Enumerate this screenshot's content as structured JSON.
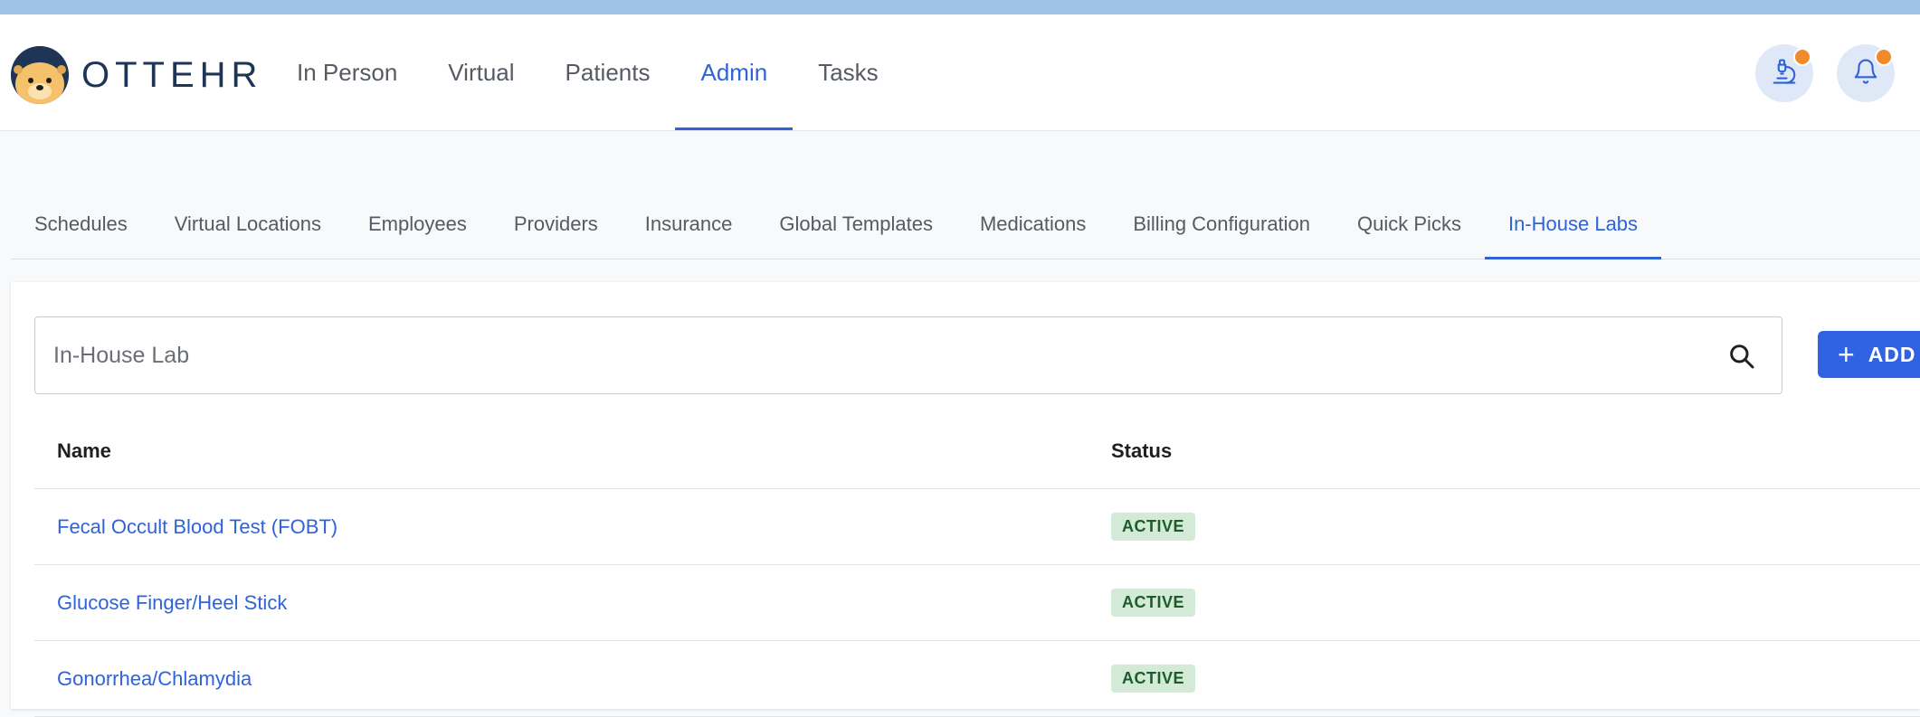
{
  "app": {
    "logo_text": "OTTEHR"
  },
  "main_nav": [
    {
      "label": "In Person",
      "active": false
    },
    {
      "label": "Virtual",
      "active": false
    },
    {
      "label": "Patients",
      "active": false
    },
    {
      "label": "Admin",
      "active": true
    },
    {
      "label": "Tasks",
      "active": false
    }
  ],
  "header_icons": {
    "labs": "microscope-icon",
    "notifications": "bell-icon"
  },
  "sub_nav": [
    {
      "label": "Schedules"
    },
    {
      "label": "Virtual Locations"
    },
    {
      "label": "Employees"
    },
    {
      "label": "Providers"
    },
    {
      "label": "Insurance"
    },
    {
      "label": "Global Templates"
    },
    {
      "label": "Medications"
    },
    {
      "label": "Billing Configuration"
    },
    {
      "label": "Quick Picks"
    },
    {
      "label": "In-House Labs",
      "active": true
    }
  ],
  "search": {
    "placeholder": "In-House Lab",
    "value": ""
  },
  "add_button": {
    "label": "ADD"
  },
  "table": {
    "columns": [
      "Name",
      "Status"
    ],
    "rows": [
      {
        "name": "Fecal Occult Blood Test (FOBT)",
        "status": "ACTIVE"
      },
      {
        "name": "Glucose Finger/Heel Stick",
        "status": "ACTIVE"
      },
      {
        "name": "Gonorrhea/Chlamydia",
        "status": "ACTIVE"
      }
    ]
  },
  "colors": {
    "accent": "#2f63d6",
    "add_button": "#2f63e3",
    "top_strip": "#9fc2e7",
    "badge_bg": "#d3ead6",
    "badge_text": "#1c5b2a",
    "notification_dot": "#f08a2a"
  }
}
